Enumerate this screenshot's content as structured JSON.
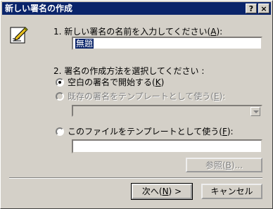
{
  "dialog": {
    "title": "新しい署名の作成",
    "help_glyph": "?",
    "close_glyph": "×"
  },
  "step1": {
    "label_prefix": "1. 新しい署名の名前を入力してください(",
    "label_key": "A",
    "label_suffix": "):",
    "name_value": "無題"
  },
  "step2": {
    "label": "2. 署名の作成方法を選択してください :",
    "option_blank": {
      "prefix": "空白の署名で開始する(",
      "key": "K",
      "suffix": ")",
      "selected": true
    },
    "option_template": {
      "prefix": "既存の署名をテンプレートとして使う(",
      "key": "E",
      "suffix": "):",
      "enabled": false
    },
    "option_file": {
      "prefix": "このファイルをテンプレートとして使う(",
      "key": "F",
      "suffix": "):"
    },
    "browse": {
      "prefix": "参照(",
      "key": "B",
      "suffix": ")..."
    }
  },
  "footer": {
    "next": {
      "prefix": "次へ(",
      "key": "N",
      "suffix": ") >"
    },
    "cancel": "キャンセル"
  }
}
